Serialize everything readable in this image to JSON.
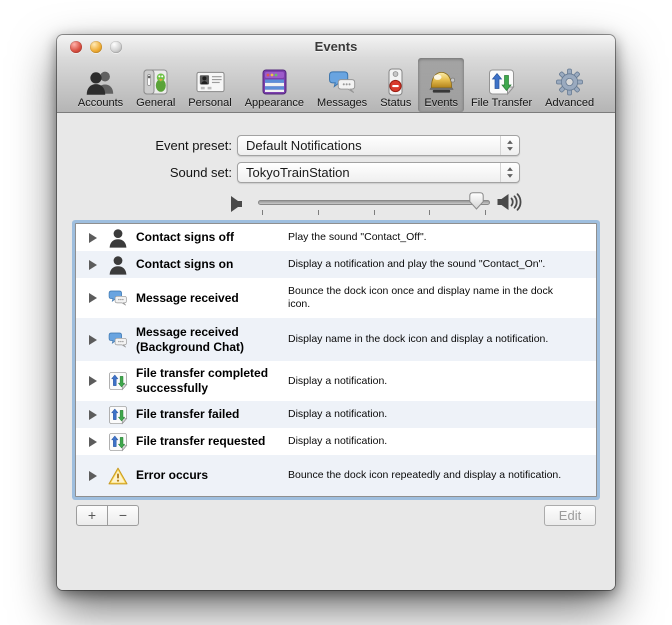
{
  "window": {
    "title": "Events"
  },
  "toolbar": {
    "items": [
      {
        "id": "accounts",
        "icon": "accounts",
        "label": "Accounts",
        "selected": false
      },
      {
        "id": "general",
        "icon": "general",
        "label": "General",
        "selected": false
      },
      {
        "id": "personal",
        "icon": "personal",
        "label": "Personal",
        "selected": false
      },
      {
        "id": "appearance",
        "icon": "appearance",
        "label": "Appearance",
        "selected": false
      },
      {
        "id": "messages",
        "icon": "messages",
        "label": "Messages",
        "selected": false
      },
      {
        "id": "status",
        "icon": "status",
        "label": "Status",
        "selected": false
      },
      {
        "id": "events",
        "icon": "events",
        "label": "Events",
        "selected": true
      },
      {
        "id": "file-transfer",
        "icon": "filetransfer",
        "label": "File Transfer",
        "selected": false
      },
      {
        "id": "advanced",
        "icon": "advanced",
        "label": "Advanced",
        "selected": false
      }
    ]
  },
  "form": {
    "event_preset_label": "Event preset:",
    "event_preset_value": "Default Notifications",
    "sound_set_label": "Sound set:",
    "sound_set_value": "TokyoTrainStation",
    "volume": {
      "percent": 94,
      "tick_count": 5
    }
  },
  "events": [
    {
      "icon": "person",
      "name": "Contact signs off",
      "description": "Play the sound \"Contact_Off\"."
    },
    {
      "icon": "person",
      "name": "Contact signs on",
      "description": "Display a notification and play the sound \"Contact_On\"."
    },
    {
      "icon": "message",
      "name": "Message received",
      "description": "Bounce the dock icon once and display name in the dock icon."
    },
    {
      "icon": "message",
      "name": "Message received (Background Chat)",
      "description": "Display name in the dock icon and display a notification."
    },
    {
      "icon": "file",
      "name": "File transfer completed successfully",
      "description": "Display a notification."
    },
    {
      "icon": "file",
      "name": "File transfer failed",
      "description": "Display a notification."
    },
    {
      "icon": "file",
      "name": "File transfer requested",
      "description": "Display a notification."
    },
    {
      "icon": "warning",
      "name": "Error occurs",
      "description": "Bounce the dock icon repeatedly and display a notification."
    }
  ],
  "footer": {
    "add_label": "+",
    "remove_label": "−",
    "edit_label": "Edit"
  },
  "colors": {
    "focus_ring": "#76a7d8",
    "alt_row": "#eef2f8",
    "content_bg": "#e8e8e8",
    "selected_toolbar_shade": "rgba(0,0,0,0.25)"
  }
}
